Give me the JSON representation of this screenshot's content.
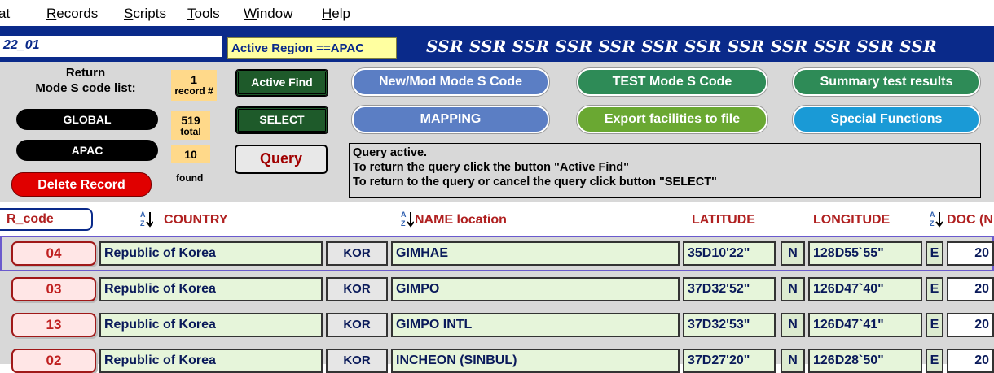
{
  "menu": [
    {
      "label": "at",
      "first": "",
      "rest": "at"
    },
    {
      "label": "Records",
      "first": "R",
      "rest": "ecords"
    },
    {
      "label": "Scripts",
      "first": "S",
      "rest": "cripts"
    },
    {
      "label": "Tools",
      "first": "T",
      "rest": "ools"
    },
    {
      "label": "Window",
      "first": "W",
      "rest": "indow"
    },
    {
      "label": "Help",
      "first": "H",
      "rest": "elp"
    }
  ],
  "header": {
    "layout_id": "22_01",
    "active_region": "Active Region ==APAC",
    "ssr_strip": "SSR  SSR  SSR  SSR  SSR  SSR  SSR  SSR  SSR  SSR  SSR  SSR"
  },
  "panel": {
    "return_label": "Return\nMode S code list:",
    "global_label": "GLOBAL",
    "apac_label": "APAC",
    "delete_label": "Delete Record",
    "record_num": "1",
    "record_caption": "record #",
    "total_num": "519",
    "total_caption": "total",
    "found_num": "10",
    "found_caption": "found",
    "active_find_label": "Active Find",
    "select_label": "SELECT",
    "query_label": "Query",
    "new_mod_label": "New/Mod Mode S Code",
    "test_label": "TEST Mode S Code",
    "summary_label": "Summary test results",
    "mapping_label": "MAPPING",
    "export_label": "Export facilities to file",
    "special_label": "Special Functions",
    "message": [
      "Query active.",
      "To return the query click the button \"Active Find\"",
      "To return to the query or cancel the query click button \"SELECT\""
    ]
  },
  "columns": {
    "code": "R_code",
    "country": "COUNTRY",
    "name": "NAME location",
    "latitude": "LATITUDE",
    "longitude": "LONGITUDE",
    "doc": "DOC (N"
  },
  "rows": [
    {
      "code": "04",
      "country": "Republic of Korea",
      "iso": "KOR",
      "name": "GIMHAE",
      "lat": "35D10'22\"",
      "ns": "N",
      "lon": "128D55`55\"",
      "ew": "E",
      "doc": "20"
    },
    {
      "code": "03",
      "country": "Republic of Korea",
      "iso": "KOR",
      "name": "GIMPO",
      "lat": "37D32'52\"",
      "ns": "N",
      "lon": "126D47`40\"",
      "ew": "E",
      "doc": "20"
    },
    {
      "code": "13",
      "country": "Republic of Korea",
      "iso": "KOR",
      "name": "GIMPO INTL",
      "lat": "37D32'53\"",
      "ns": "N",
      "lon": "126D47`41\"",
      "ew": "E",
      "doc": "20"
    },
    {
      "code": "02",
      "country": "Republic of Korea",
      "iso": "KOR",
      "name": "INCHEON (SINBUL)",
      "lat": "37D27'20\"",
      "ns": "N",
      "lon": "126D28`50\"",
      "ew": "E",
      "doc": "20"
    }
  ],
  "colors": {
    "header_blue": "#0a2a8a",
    "active_find_green": "#1e5a2a",
    "new_mod_blue": "#5b7ec4",
    "test_green": "#2e8b57",
    "summary_green": "#2e8b57",
    "mapping_blue": "#5b7ec4",
    "export_green": "#6aa832",
    "special_blue": "#1a9ad6"
  }
}
